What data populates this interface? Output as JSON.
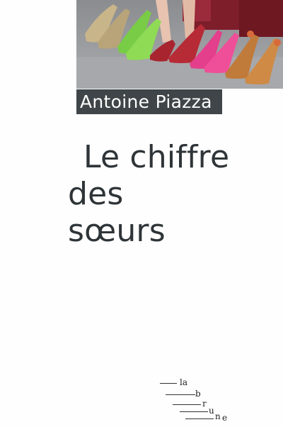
{
  "cover": {
    "author": "Antoine Piazza",
    "title_line1": "Le chiffre",
    "title_line2": "des sœurs",
    "publisher_letters": [
      "la",
      "b",
      "r",
      "u",
      "n",
      "e"
    ]
  },
  "photo": {
    "subject": "row of women's high-heeled shoes",
    "colors": [
      "#c9b58a",
      "#7fd14a",
      "#a8252f",
      "#e33f8c",
      "#c07a3a"
    ]
  }
}
